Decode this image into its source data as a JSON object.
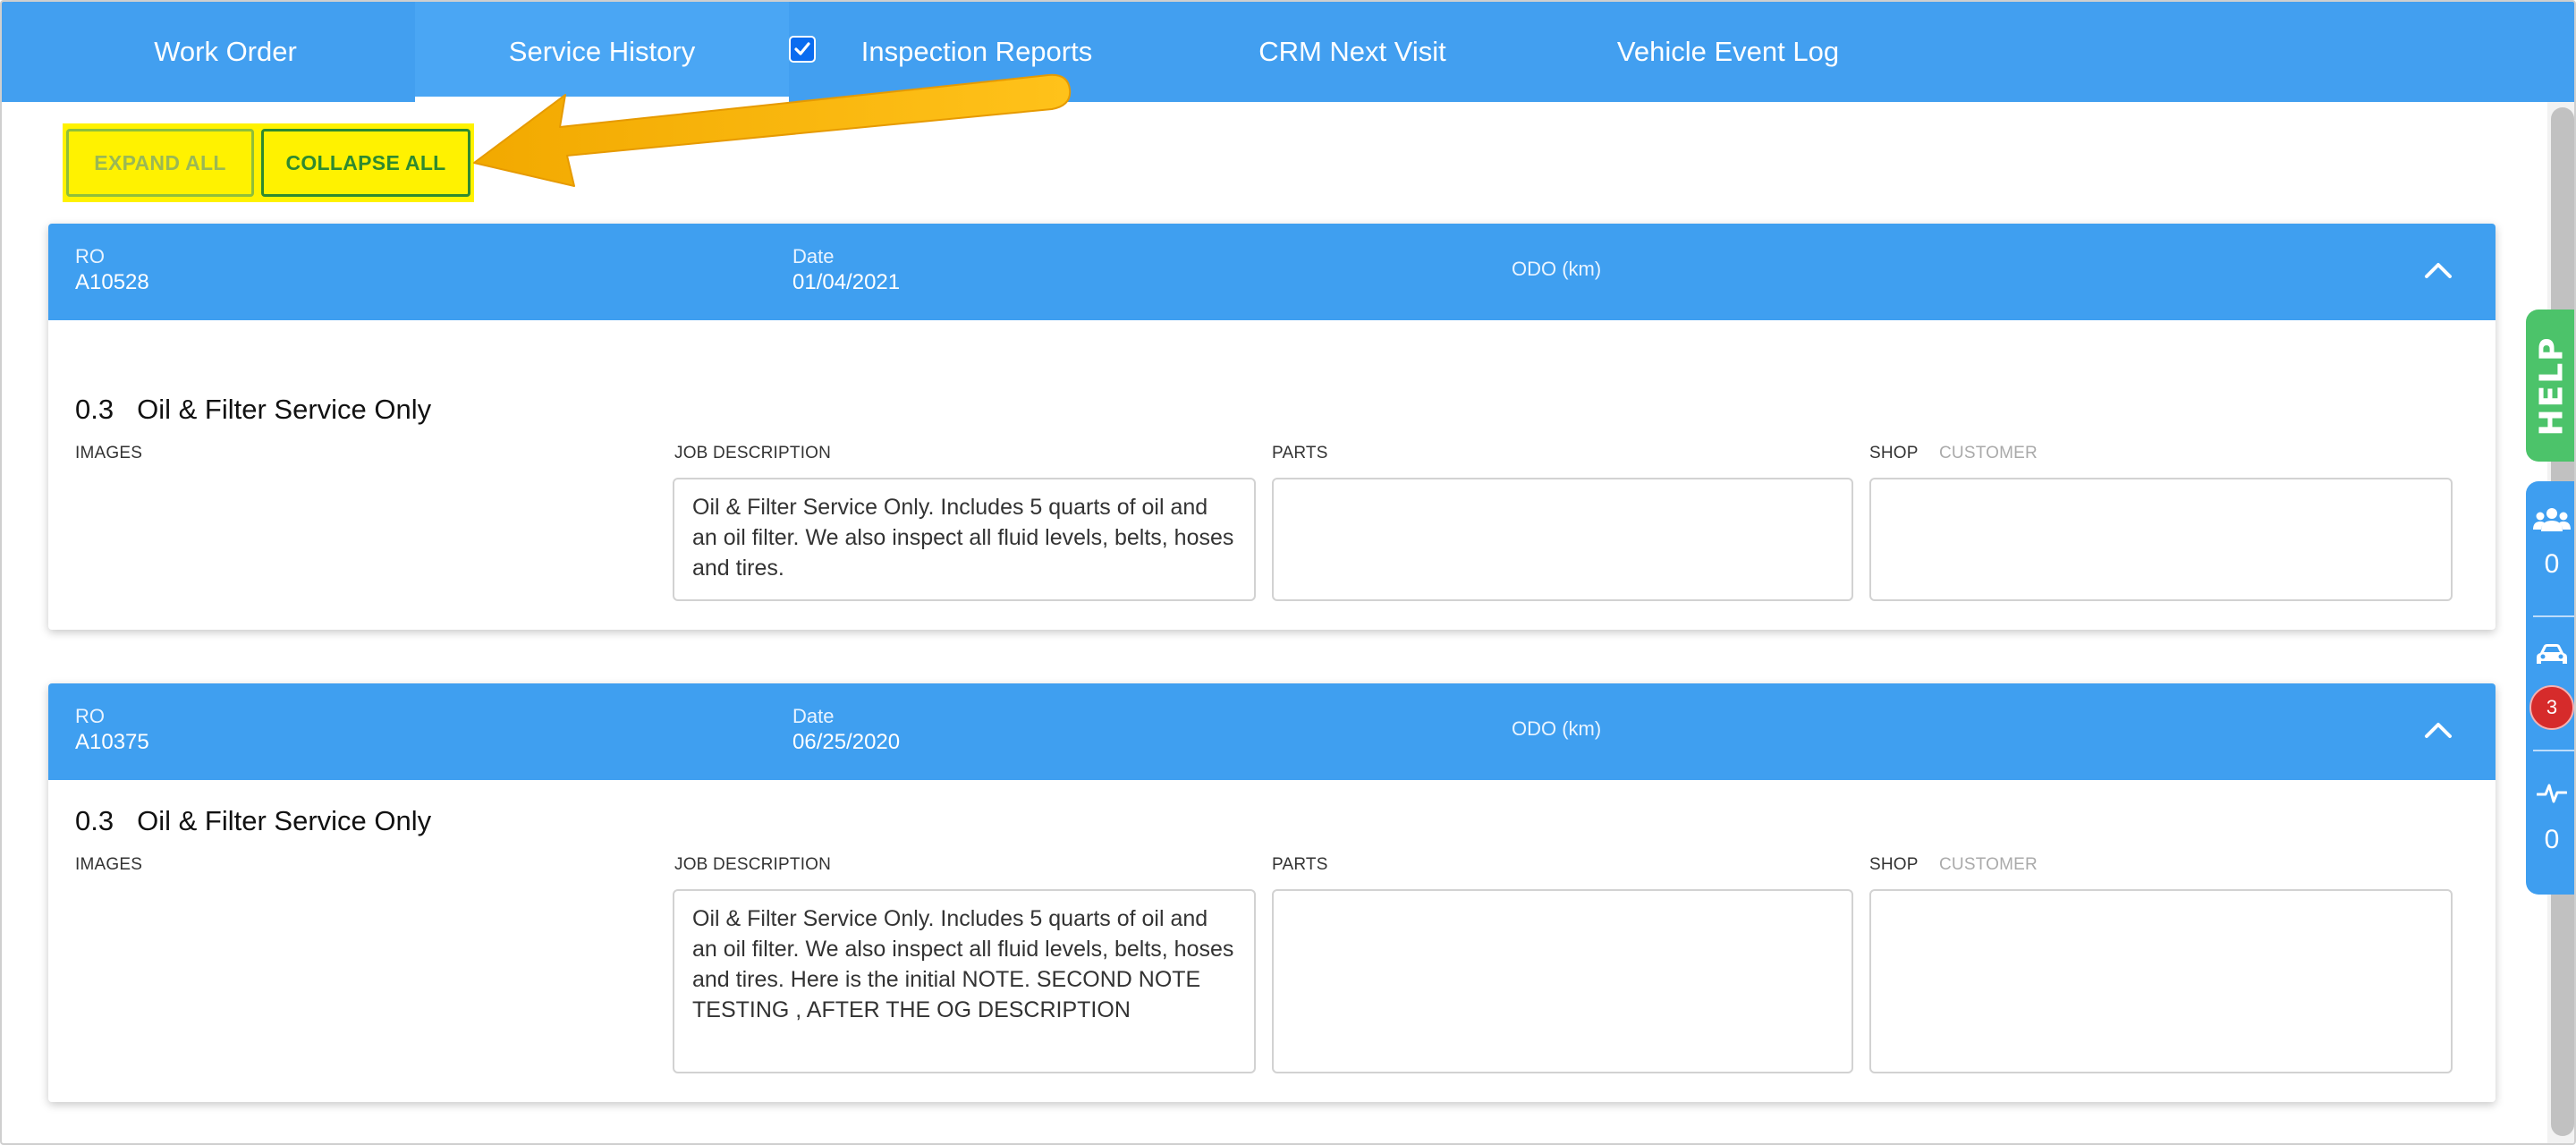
{
  "tabs": [
    {
      "label": "Work Order"
    },
    {
      "label": "Service History"
    },
    {
      "label": "Inspection Reports"
    },
    {
      "label": "CRM Next Visit"
    },
    {
      "label": "Vehicle Event Log"
    }
  ],
  "actions": {
    "expand_all": "EXPAND ALL",
    "collapse_all": "COLLAPSE ALL"
  },
  "header_labels": {
    "ro": "RO",
    "date": "Date",
    "odo": "ODO (km)"
  },
  "column_labels": {
    "images": "IMAGES",
    "job_description": "JOB DESCRIPTION",
    "parts": "PARTS",
    "shop": "SHOP",
    "customer": "CUSTOMER"
  },
  "records": [
    {
      "ro": "A10528",
      "date": "01/04/2021",
      "job_hours": "0.3",
      "job_name": "Oil & Filter Service Only",
      "job_description": "Oil & Filter Service Only. Includes 5 quarts of oil and an oil filter. We also inspect all fluid levels, belts, hoses and tires."
    },
    {
      "ro": "A10375",
      "date": "06/25/2020",
      "job_hours": "0.3",
      "job_name": "Oil & Filter Service Only",
      "job_description": "Oil & Filter Service Only. Includes 5 quarts of oil and an oil filter. We also inspect all fluid levels, belts, hoses and tires. Here is the initial NOTE. SECOND NOTE TESTING , AFTER THE OG DESCRIPTION"
    }
  ],
  "side_panel": {
    "help_label": "HELP",
    "customers_count": "0",
    "vehicles_badge": "3",
    "activity_count": "0"
  },
  "colors": {
    "tab_bar": "#429ff0",
    "help": "#4cc36a",
    "highlight": "#fff200",
    "badge": "#d62b2b"
  }
}
